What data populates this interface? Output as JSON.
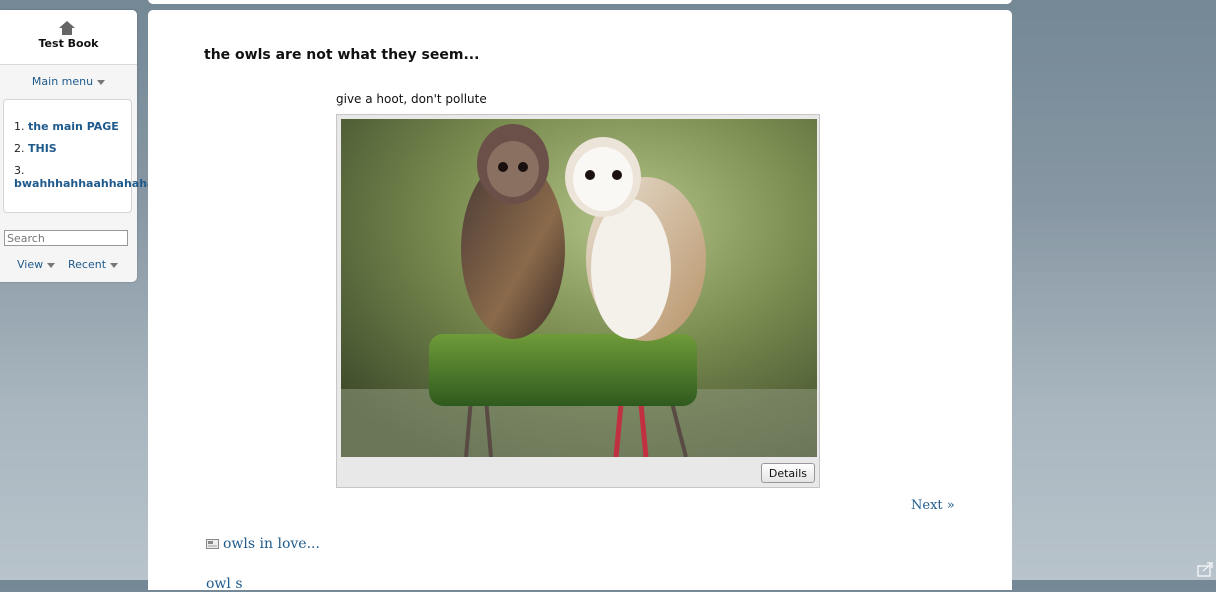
{
  "sidebar": {
    "book_title": "Test Book",
    "main_menu_label": "Main menu",
    "menu_items": [
      {
        "number": "1.",
        "label": "the main PAGE"
      },
      {
        "number": "2.",
        "label": "THIS"
      },
      {
        "number": "3.",
        "label": "bwahhhahhaahhahaha"
      }
    ],
    "search_placeholder": "Search",
    "view_label": "View",
    "recent_label": "Recent"
  },
  "page": {
    "title": "the owls are not what they seem...",
    "image_caption": "give a hoot, don't pollute",
    "details_button": "Details",
    "next_link": "Next »",
    "related_link": "owls in love...",
    "related_link_2": "owl s"
  },
  "icons": {
    "home": "home-icon",
    "caret": "chevron-down-icon",
    "related_page": "page-icon",
    "share": "share-icon"
  },
  "colors": {
    "link": "#1f5a8c",
    "background_top": "#748896",
    "background_bottom": "#b8c3cb"
  }
}
